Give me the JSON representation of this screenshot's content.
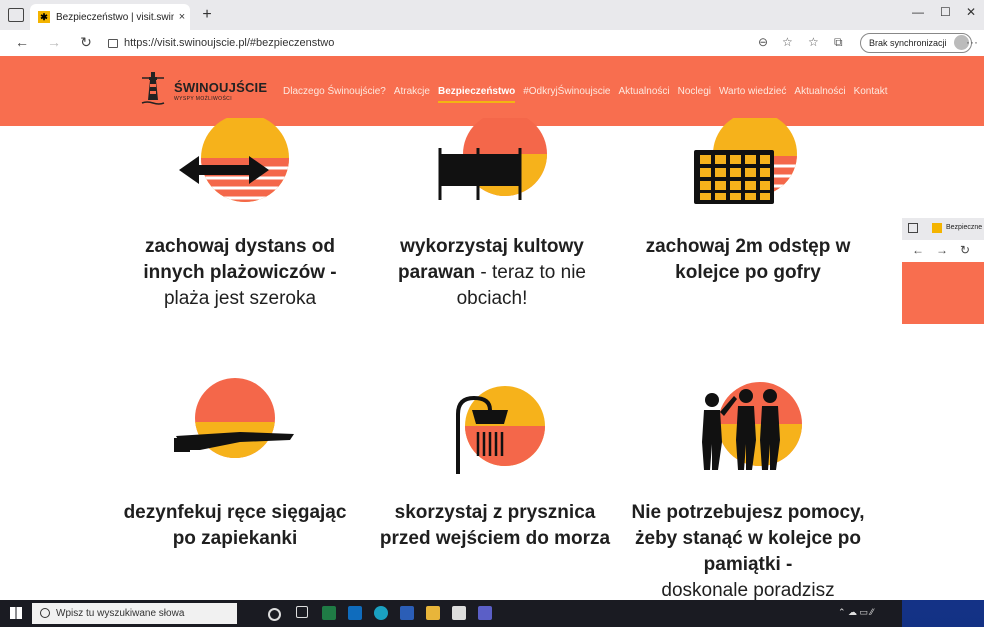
{
  "browser": {
    "tab_title": "Bezpieczeństwo | visit.swinoujsc",
    "tab_close": "×",
    "new_tab": "+",
    "url": "https://visit.swinoujscie.pl/#bezpieczenstwo",
    "sync_label": "Brak synchronizacji",
    "more": "···"
  },
  "site": {
    "logo_name": "ŚWINOUJŚCIE",
    "logo_sub": "WYSPY MOŻLIWOŚCI",
    "menu": [
      {
        "label": "Dlaczego Świnoujście?"
      },
      {
        "label": "Atrakcje"
      },
      {
        "label": "Bezpieczeństwo",
        "active": true
      },
      {
        "label": "#OdkryjŚwinoujscie"
      },
      {
        "label": "Aktualności"
      },
      {
        "label": "Noclegi"
      },
      {
        "label": "Warto wiedzieć"
      },
      {
        "label": "Aktualności"
      },
      {
        "label": "Kontakt"
      }
    ]
  },
  "tips": [
    {
      "bold": "zachowaj dystans od innych plażowiczów -",
      "light": "plaża jest szeroka"
    },
    {
      "bold": "wykorzystaj kultowy parawan",
      "light": " - teraz to nie obciach!"
    },
    {
      "bold": "zachowaj 2m odstęp w kolejce po gofry",
      "light": ""
    },
    {
      "bold": "dezynfekuj ręce sięgając po zapiekanki",
      "light": ""
    },
    {
      "bold": "skorzystaj z prysznica przed wejściem do morza",
      "light": ""
    },
    {
      "bold": "Nie potrzebujesz pomocy, żeby stanąć w kolejce po pamiątki -",
      "light": "doskonale poradzisz"
    }
  ],
  "taskbar": {
    "search_placeholder": "Wpisz tu wyszukiwane słowa"
  },
  "colors": {
    "brand": "#f86e4f",
    "sun_yellow": "#f6b21b",
    "sun_red": "#f4674a",
    "accent_underline": "#f3b512"
  }
}
